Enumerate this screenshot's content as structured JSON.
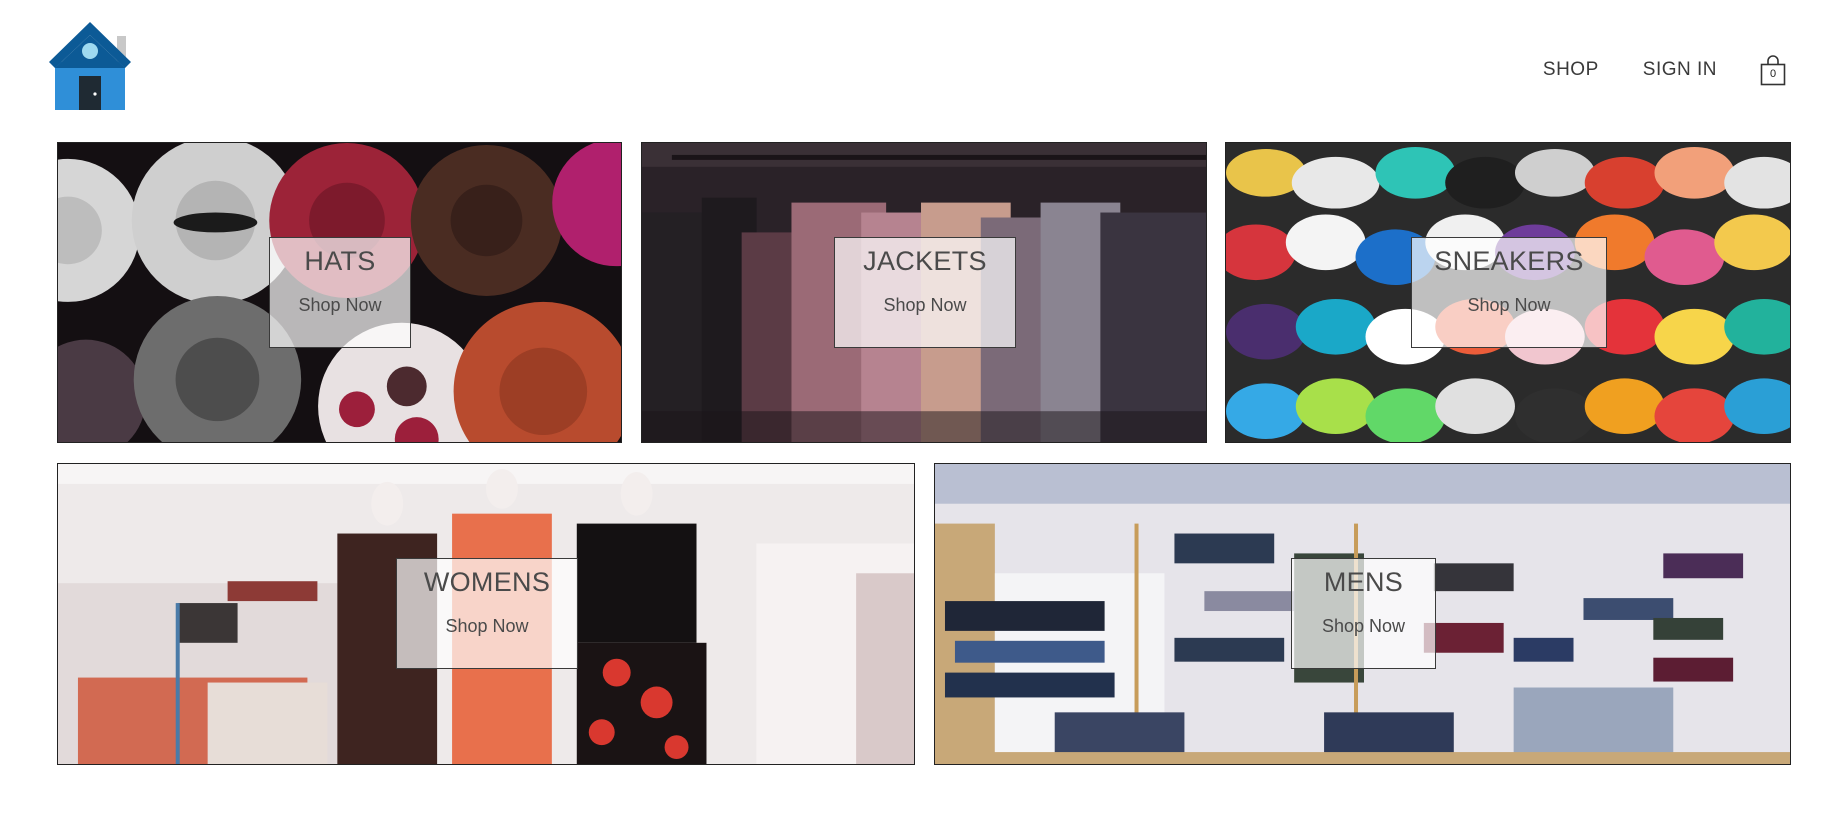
{
  "header": {
    "logo_icon": "house-logo-icon",
    "nav": {
      "shop": "SHOP",
      "sign_in": "SIGN IN"
    },
    "cart": {
      "icon": "shopping-bag-icon",
      "count": "0"
    }
  },
  "categories": [
    {
      "title": "HATS",
      "action": "Shop Now"
    },
    {
      "title": "JACKETS",
      "action": "Shop Now"
    },
    {
      "title": "SNEAKERS",
      "action": "Shop Now"
    },
    {
      "title": "WOMENS",
      "action": "Shop Now"
    },
    {
      "title": "MENS",
      "action": "Shop Now"
    }
  ],
  "colors": {
    "logo_dark_blue": "#0c5a96",
    "logo_light_blue": "#2f8fd8",
    "border": "#222222"
  }
}
